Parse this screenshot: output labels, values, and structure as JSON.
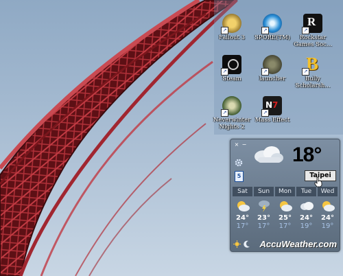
{
  "desktop_icons": [
    {
      "label": "Fallout 3"
    },
    {
      "label": "SPORE(TM)"
    },
    {
      "label": "Rockstar Games Soc..."
    },
    {
      "label": "Steam"
    },
    {
      "label": "launcher"
    },
    {
      "label": "Bully Scholarsh..."
    },
    {
      "label": "Neverwinter Nights 2"
    },
    {
      "label": "Mass Effect"
    }
  ],
  "weather": {
    "temperature": "18°",
    "city": "Taipei",
    "calendar_day": "5",
    "close_glyph": "×",
    "minimize_glyph": "−",
    "current_icon": "cloudy-icon",
    "forecast": [
      {
        "day": "Sat",
        "high": "24°",
        "low": "17°",
        "icon": "partly-cloudy-icon"
      },
      {
        "day": "Sun",
        "high": "23°",
        "low": "17°",
        "icon": "thunderstorm-icon"
      },
      {
        "day": "Mon",
        "high": "25°",
        "low": "17°",
        "icon": "partly-cloudy-icon"
      },
      {
        "day": "Tue",
        "high": "24°",
        "low": "19°",
        "icon": "cloudy-icon"
      },
      {
        "day": "Wed",
        "high": "24°",
        "low": "19°",
        "icon": "partly-cloudy-icon"
      }
    ],
    "brand": "AccuWeather.com"
  },
  "colors": {
    "sky": "#a7bcd2",
    "bridge_red": "#8a1a1f",
    "gadget_bg": "#6b7c8e"
  }
}
